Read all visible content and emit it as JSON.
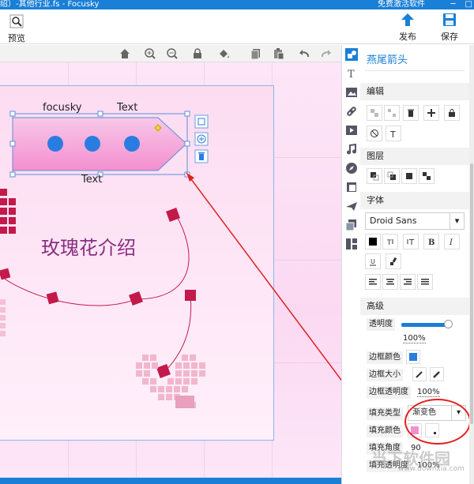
{
  "title_bar": {
    "title": "绍）-其他行业.fs - Focusky",
    "register": "免费激活软件"
  },
  "toolbar": {
    "preview_label": "预览",
    "publish_label": "发布",
    "save_label": "保存"
  },
  "canvas": {
    "arrow_label_top_left": "focusky",
    "arrow_label_top_right": "Text",
    "arrow_label_bottom": "Text",
    "heading": "玫瑰花介绍"
  },
  "panel": {
    "title": "燕尾箭头",
    "edit_section": "编辑",
    "layer_section": "图层",
    "font_section": "字体",
    "font_name": "Droid Sans",
    "advanced_section": "高级",
    "opacity_label": "透明度",
    "opacity_value": "100%",
    "opacity_level": 1.0,
    "border_color_label": "边框颜色",
    "border_size_label": "边框大小",
    "border_opacity_label": "边框透明度",
    "border_opacity_value": "100%",
    "fill_type_label": "填充类型",
    "fill_type_value": "渐变色",
    "fill_color_label": "填充颜色",
    "fill_angle_label": "填充角度",
    "fill_angle_value": "90",
    "fill_opacity_label": "填充透明度",
    "fill_opacity_value": "100%"
  },
  "colors": {
    "accent": "#1a7fd6",
    "rose": "#c21a4a",
    "fill_pink": "#f48fd0"
  },
  "watermark": {
    "text": "当下软件园",
    "url": "www.downxia.com"
  }
}
